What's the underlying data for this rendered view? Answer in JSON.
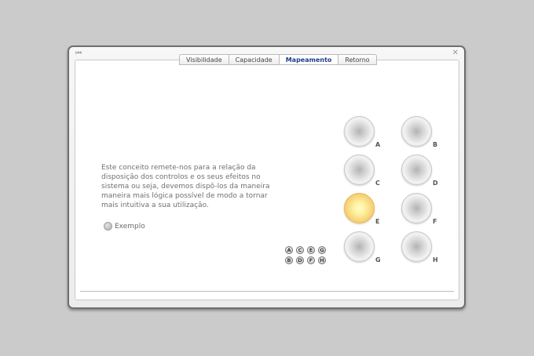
{
  "window": {
    "back_icon": "skip-back-icon",
    "close_icon": "close-icon"
  },
  "tabs": [
    "Visibilidade",
    "Capacidade",
    "Mapeamento",
    "Retorno"
  ],
  "active_tab": "Mapeamento",
  "description": "Este conceito remete-nos para a relação da disposição dos controlos e os seus efeitos no sistema ou seja, devemos dispô-los da maneira maneira mais lógica possível de modo a tornar mais intuitiva a sua utilização.",
  "example_label": "Exemplo",
  "dials": [
    {
      "label": "A",
      "lit": false
    },
    {
      "label": "B",
      "lit": false
    },
    {
      "label": "C",
      "lit": false
    },
    {
      "label": "D",
      "lit": false
    },
    {
      "label": "E",
      "lit": true
    },
    {
      "label": "F",
      "lit": false
    },
    {
      "label": "G",
      "lit": false
    },
    {
      "label": "H",
      "lit": false
    }
  ],
  "mini_knobs": [
    "A",
    "C",
    "E",
    "G",
    "B",
    "D",
    "F",
    "H"
  ],
  "colors": {
    "active_tab_text": "#1f3d8c",
    "lit_dial": "#f2c14f",
    "background": "#cbcbcb"
  }
}
